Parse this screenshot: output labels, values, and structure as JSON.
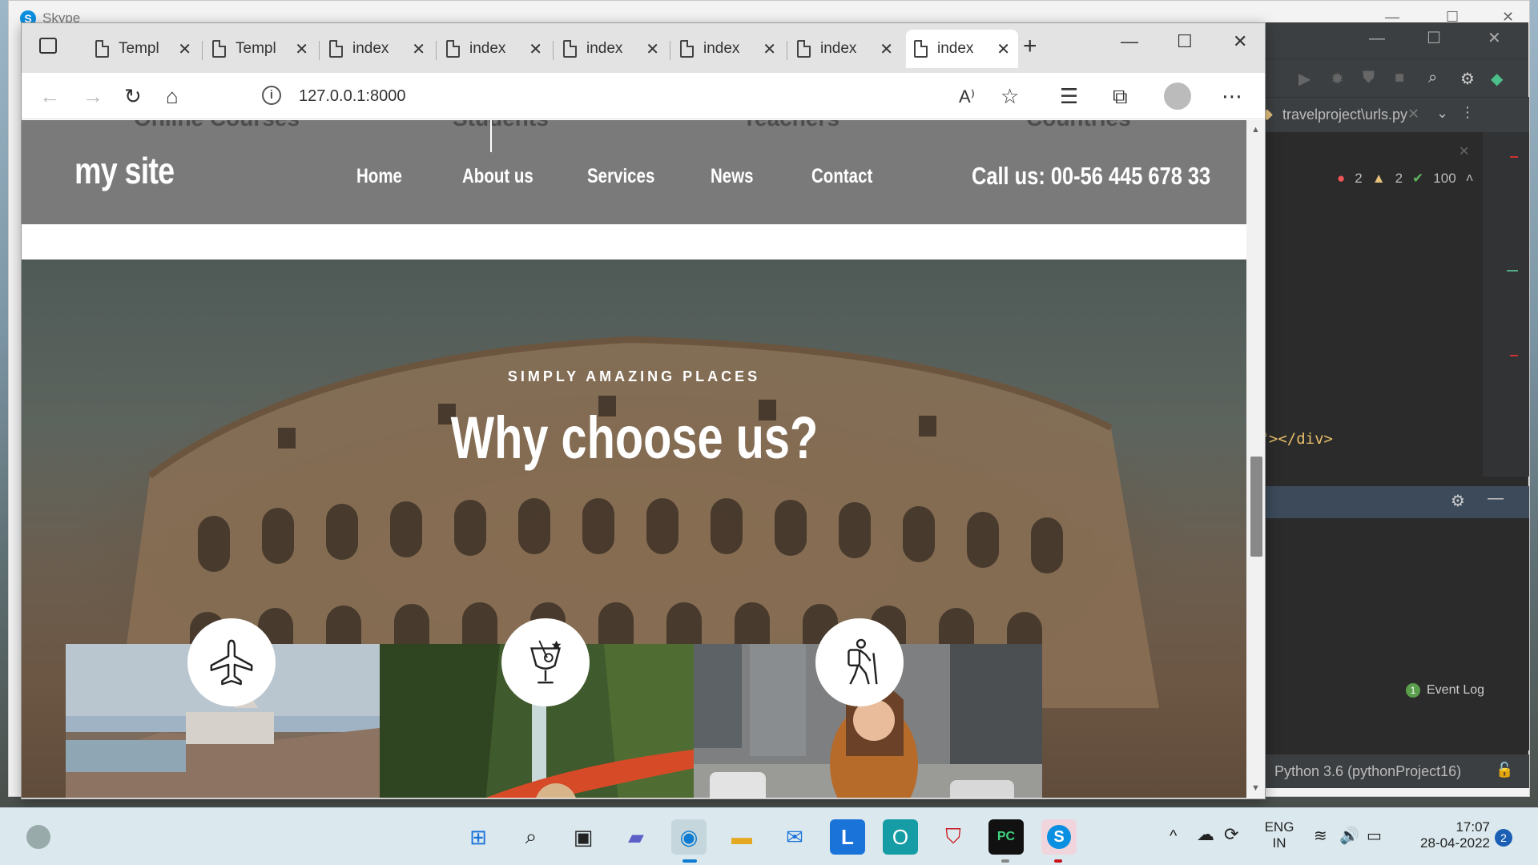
{
  "skype": {
    "title": "Skype"
  },
  "browser": {
    "tabs": [
      {
        "label": "Templ"
      },
      {
        "label": "Templ"
      },
      {
        "label": "index"
      },
      {
        "label": "index"
      },
      {
        "label": "index"
      },
      {
        "label": "index"
      },
      {
        "label": "index"
      },
      {
        "label": "index"
      }
    ],
    "url": "127.0.0.1:8000"
  },
  "site": {
    "ghost_labels": [
      "Online Courses",
      "Students",
      "Teachers",
      "Countries"
    ],
    "logo": "my site",
    "nav": [
      "Home",
      "About us",
      "Services",
      "News",
      "Contact"
    ],
    "call": "Call us: 00-56 445 678 33",
    "hero_subtitle": "SIMPLY AMAZING PLACES",
    "hero_title": "Why choose us?"
  },
  "pycharm": {
    "tab": "travelproject\\urls.py",
    "errors": "2",
    "warnings": "2",
    "ok": "100",
    "code": ")\"></div>",
    "event_count": "1",
    "event_log": "Event Log",
    "interpreter": "Python 3.6 (pythonProject16)"
  },
  "taskbar": {
    "lang_top": "ENG",
    "lang_bottom": "IN",
    "time": "17:07",
    "date": "28-04-2022",
    "notif": "2"
  },
  "colors": {
    "header_bg": "#7a7a7a",
    "accent": "#0b8fe0"
  }
}
